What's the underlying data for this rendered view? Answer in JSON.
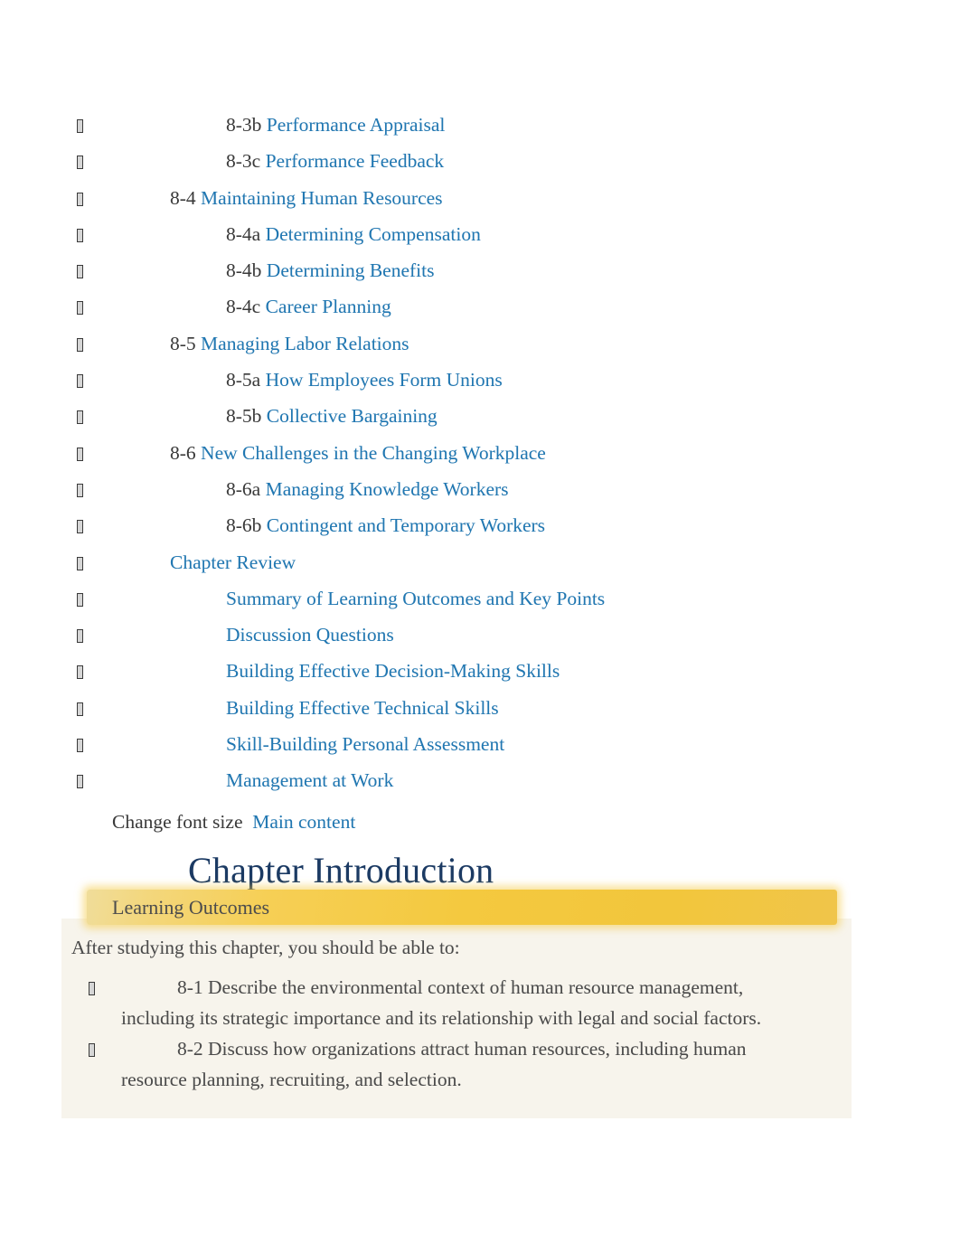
{
  "toc": {
    "items": [
      {
        "level": 2,
        "number": "8-3b",
        "label": "Performance Appraisal"
      },
      {
        "level": 2,
        "number": "8-3c",
        "label": "Performance Feedback"
      },
      {
        "level": 1,
        "number": "8-4",
        "label": "Maintaining Human Resources"
      },
      {
        "level": 2,
        "number": "8-4a",
        "label": "Determining Compensation"
      },
      {
        "level": 2,
        "number": "8-4b",
        "label": "Determining Benefits"
      },
      {
        "level": 2,
        "number": "8-4c",
        "label": "Career Planning"
      },
      {
        "level": 1,
        "number": "8-5",
        "label": "Managing Labor Relations"
      },
      {
        "level": 2,
        "number": "8-5a",
        "label": "How Employees Form Unions"
      },
      {
        "level": 2,
        "number": "8-5b",
        "label": "Collective Bargaining"
      },
      {
        "level": 1,
        "number": "8-6",
        "label": "New Challenges in the Changing Workplace"
      },
      {
        "level": 2,
        "number": "8-6a",
        "label": "Managing Knowledge Workers"
      },
      {
        "level": 2,
        "number": "8-6b",
        "label": "Contingent and Temporary Workers"
      },
      {
        "level": 1,
        "number": "",
        "label": "Chapter Review"
      },
      {
        "level": 2,
        "number": "",
        "label": "Summary of Learning Outcomes and Key Points"
      },
      {
        "level": 2,
        "number": "",
        "label": "Discussion Questions"
      },
      {
        "level": 2,
        "number": "",
        "label": "Building Effective Decision-Making Skills"
      },
      {
        "level": 2,
        "number": "",
        "label": "Building Effective Technical Skills"
      },
      {
        "level": 2,
        "number": "",
        "label": "Skill-Building Personal Assessment"
      },
      {
        "level": 2,
        "number": "",
        "label": "Management at Work"
      }
    ],
    "bullet_glyph": "missing-glyph-box"
  },
  "font_size_line": {
    "static_text": "Change font size",
    "link_text": "Main content"
  },
  "chapter": {
    "title": "Chapter Introduction"
  },
  "learning_outcomes": {
    "banner_label": "Learning Outcomes",
    "intro": "After studying this chapter, you should be able to:",
    "items": [
      {
        "number": "8-1",
        "text": "8-1 Describe the environmental context of human resource management, including its strategic importance and its relationship with legal and social factors."
      },
      {
        "number": "8-2",
        "text": "8-2 Discuss how organizations attract human resources, including human resource planning, recruiting, and selection."
      }
    ]
  },
  "colors": {
    "link_blue": "#2077b2",
    "heading_navy": "#1b3a63",
    "body_gray": "#4a4a4a",
    "banner_gold": "#f4c93f",
    "panel_cream": "#f7f4ec"
  }
}
